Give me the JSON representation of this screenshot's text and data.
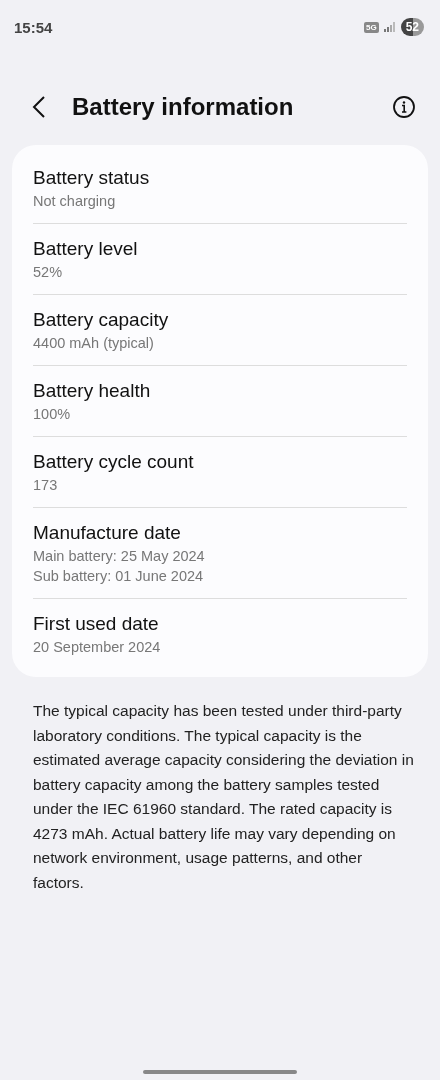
{
  "status_bar": {
    "time": "15:54",
    "network": "5G",
    "battery": "52"
  },
  "header": {
    "title": "Battery information"
  },
  "items": [
    {
      "title": "Battery status",
      "values": [
        "Not charging"
      ]
    },
    {
      "title": "Battery level",
      "values": [
        "52%"
      ]
    },
    {
      "title": "Battery capacity",
      "values": [
        "4400 mAh (typical)"
      ]
    },
    {
      "title": "Battery health",
      "values": [
        "100%"
      ]
    },
    {
      "title": "Battery cycle count",
      "values": [
        "173"
      ]
    },
    {
      "title": "Manufacture date",
      "values": [
        "Main battery: 25 May 2024",
        "Sub battery: 01 June 2024"
      ]
    },
    {
      "title": "First used date",
      "values": [
        "20 September 2024"
      ]
    }
  ],
  "note": "The typical capacity has been tested under third-party laboratory conditions. The typical capacity is the estimated average capacity considering the deviation in battery capacity among the battery samples tested under the IEC 61960 standard. The rated capacity is 4273 mAh. Actual battery life may vary depending on network environment, usage patterns, and other factors."
}
